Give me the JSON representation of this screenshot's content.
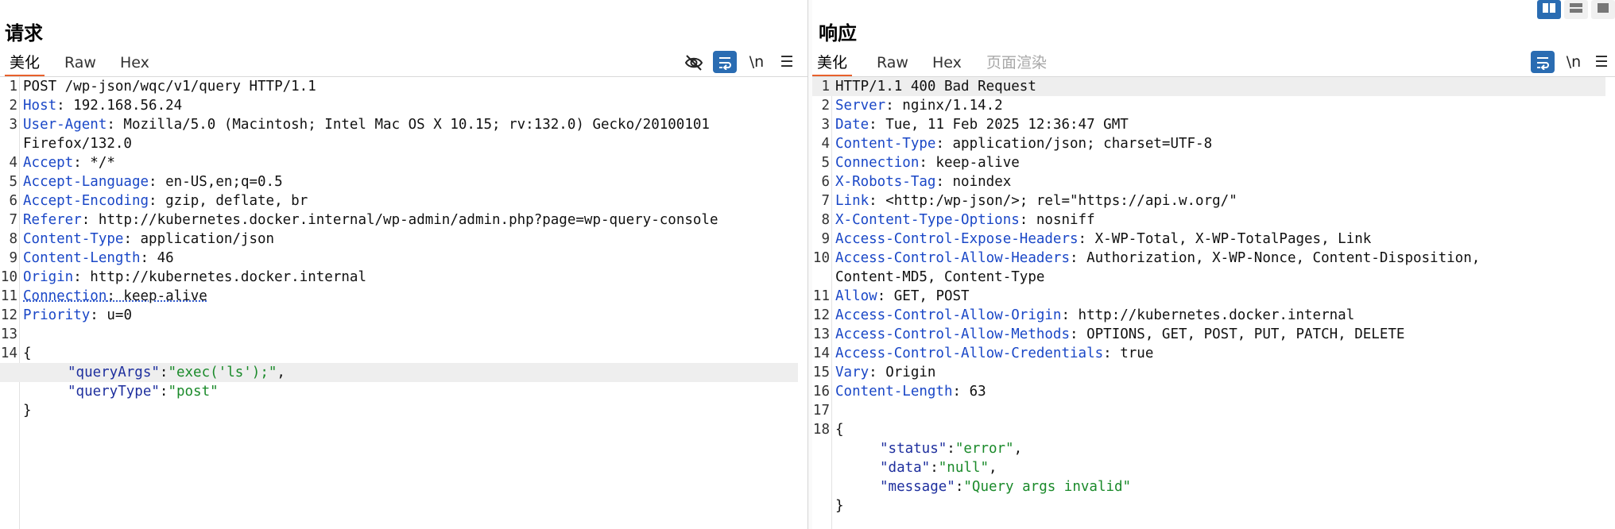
{
  "request": {
    "title": "请求",
    "tabs": [
      "美化",
      "Raw",
      "Hex"
    ],
    "toolbar": {
      "eye_icon": "eye-off-icon",
      "wrap_icon": "wrap-icon",
      "newline_label": "\\n",
      "menu_icon": "menu-icon"
    },
    "lines": [
      {
        "num": "1",
        "key": "",
        "value": "POST /wp-json/wqc/v1/query HTTP/1.1"
      },
      {
        "num": "2",
        "key": "Host",
        "value": ": 192.168.56.24"
      },
      {
        "num": "3",
        "key": "User-Agent",
        "value": ": Mozilla/5.0 (Macintosh; Intel Mac OS X 10.15; rv:132.0) Gecko/20100101"
      },
      {
        "num": "",
        "key": "",
        "value": "Firefox/132.0"
      },
      {
        "num": "4",
        "key": "Accept",
        "value": ": */*"
      },
      {
        "num": "5",
        "key": "Accept-Language",
        "value": ": en-US,en;q=0.5"
      },
      {
        "num": "6",
        "key": "Accept-Encoding",
        "value": ": gzip, deflate, br"
      },
      {
        "num": "7",
        "key": "Referer",
        "value": ": http://kubernetes.docker.internal/wp-admin/admin.php?page=wp-query-console"
      },
      {
        "num": "8",
        "key": "Content-Type",
        "value": ": application/json"
      },
      {
        "num": "9",
        "key": "Content-Length",
        "value": ": 46"
      },
      {
        "num": "10",
        "key": "Origin",
        "value": ": http://kubernetes.docker.internal"
      },
      {
        "num": "11",
        "key": "Connection",
        "value": ": keep-alive"
      },
      {
        "num": "12",
        "key": "Priority",
        "value": ": u=0"
      },
      {
        "num": "13",
        "key": "",
        "value": ""
      },
      {
        "num": "14",
        "key": "",
        "value": "{"
      }
    ],
    "json_body": [
      {
        "key": "\"queryArgs\"",
        "sep": ":",
        "value": "\"exec('ls');\"",
        "tail": ","
      },
      {
        "key": "\"queryType\"",
        "sep": ":",
        "value": "\"post\"",
        "tail": ""
      }
    ],
    "closing": "}"
  },
  "response": {
    "title": "响应",
    "tabs": [
      "美化",
      "Raw",
      "Hex",
      "页面渲染"
    ],
    "toolbar": {
      "wrap_icon": "wrap-icon",
      "newline_label": "\\n",
      "menu_icon": "menu-icon"
    },
    "lines": [
      {
        "num": "1",
        "key": "",
        "value": "HTTP/1.1 400 Bad Request"
      },
      {
        "num": "2",
        "key": "Server",
        "value": ": nginx/1.14.2"
      },
      {
        "num": "3",
        "key": "Date",
        "value": ": Tue, 11 Feb 2025 12:36:47 GMT"
      },
      {
        "num": "4",
        "key": "Content-Type",
        "value": ": application/json; charset=UTF-8"
      },
      {
        "num": "5",
        "key": "Connection",
        "value": ": keep-alive"
      },
      {
        "num": "6",
        "key": "X-Robots-Tag",
        "value": ": noindex"
      },
      {
        "num": "7",
        "key": "Link",
        "value": ": <http:/wp-json/>; rel=\"https://api.w.org/\""
      },
      {
        "num": "8",
        "key": "X-Content-Type-Options",
        "value": ": nosniff"
      },
      {
        "num": "9",
        "key": "Access-Control-Expose-Headers",
        "value": ": X-WP-Total, X-WP-TotalPages, Link"
      },
      {
        "num": "10",
        "key": "Access-Control-Allow-Headers",
        "value": ": Authorization, X-WP-Nonce, Content-Disposition,"
      },
      {
        "num": "",
        "key": "",
        "value": "Content-MD5, Content-Type"
      },
      {
        "num": "11",
        "key": "Allow",
        "value": ": GET, POST"
      },
      {
        "num": "12",
        "key": "Access-Control-Allow-Origin",
        "value": ": http://kubernetes.docker.internal"
      },
      {
        "num": "13",
        "key": "Access-Control-Allow-Methods",
        "value": ": OPTIONS, GET, POST, PUT, PATCH, DELETE"
      },
      {
        "num": "14",
        "key": "Access-Control-Allow-Credentials",
        "value": ": true"
      },
      {
        "num": "15",
        "key": "Vary",
        "value": ": Origin"
      },
      {
        "num": "16",
        "key": "Content-Length",
        "value": ": 63"
      },
      {
        "num": "17",
        "key": "",
        "value": ""
      },
      {
        "num": "18",
        "key": "",
        "value": "{"
      }
    ],
    "json_body": [
      {
        "key": "\"status\"",
        "sep": ":",
        "value": "\"error\"",
        "tail": ","
      },
      {
        "key": "\"data\"",
        "sep": ":",
        "value": "\"null\"",
        "tail": ","
      },
      {
        "key": "\"message\"",
        "sep": ":",
        "value": "\"Query args invalid\"",
        "tail": ""
      }
    ],
    "closing": "}"
  },
  "layout_buttons": [
    "split-vertical-icon",
    "split-horizontal-icon",
    "single-pane-icon"
  ]
}
